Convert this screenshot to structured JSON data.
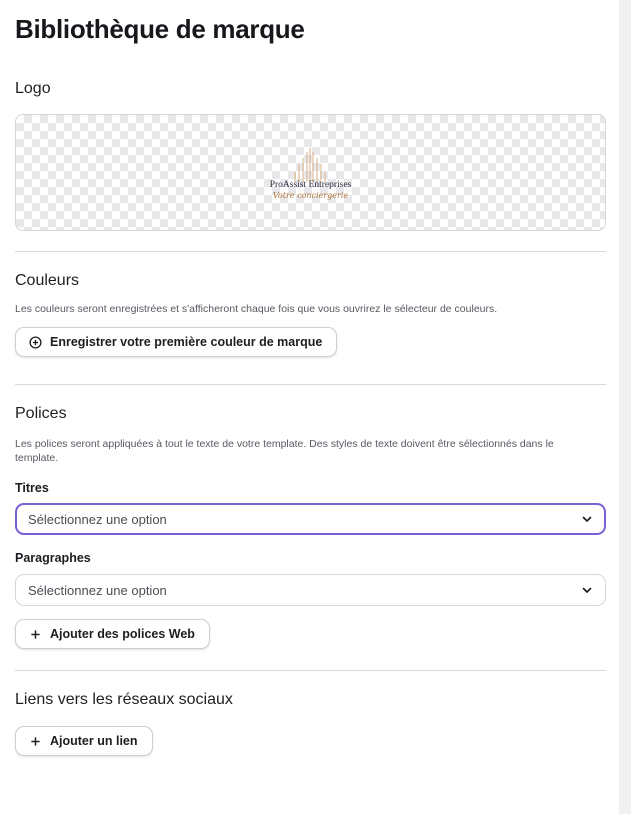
{
  "page": {
    "title": "Bibliothèque de marque"
  },
  "logo": {
    "section_title": "Logo",
    "brand_name": "ProAssist Entreprises",
    "brand_tagline": "Votre conciergerie"
  },
  "colors": {
    "section_title": "Couleurs",
    "description": "Les couleurs seront enregistrées et s'afficheront chaque fois que vous ouvrirez le sélecteur de couleurs.",
    "add_button_label": "Enregistrer votre première couleur de marque"
  },
  "fonts": {
    "section_title": "Polices",
    "description": "Les polices seront appliquées à tout le texte de votre template. Des styles de texte doivent être sélectionnés dans le template.",
    "headings": {
      "label": "Titres",
      "placeholder": "Sélectionnez une option"
    },
    "paragraphs": {
      "label": "Paragraphes",
      "placeholder": "Sélectionnez une option"
    },
    "add_web_fonts_label": "Ajouter des polices Web"
  },
  "social": {
    "section_title": "Liens vers les réseaux sociaux",
    "add_link_label": "Ajouter un lien"
  },
  "theme": {
    "focus_color": "#7b5fd6",
    "logo_gold": "#b0753c"
  }
}
